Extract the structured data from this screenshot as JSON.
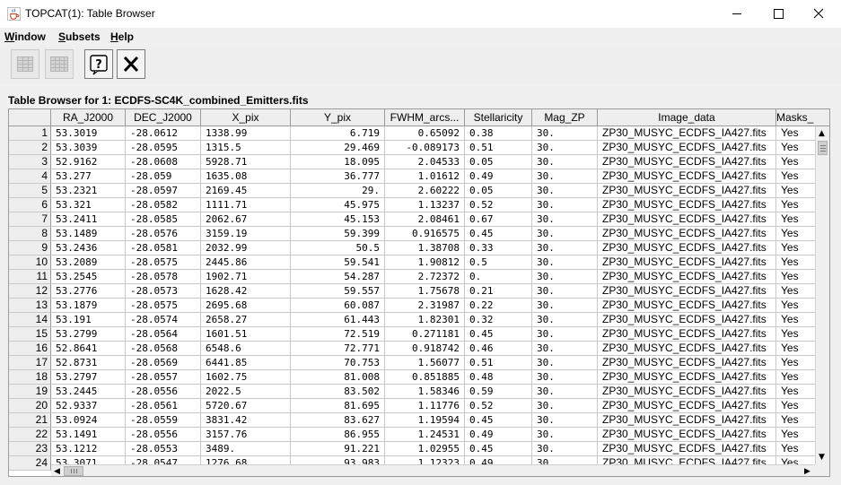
{
  "window": {
    "title": "TOPCAT(1): Table Browser",
    "app_icon": "java-cup-icon",
    "controls": [
      "minimize-icon",
      "maximize-icon",
      "close-icon"
    ]
  },
  "menu": {
    "items": [
      {
        "label": "Window",
        "mnemonic": "W",
        "rest": "indow"
      },
      {
        "label": "Subsets",
        "mnemonic": "S",
        "rest": "ubsets"
      },
      {
        "label": "Help",
        "mnemonic": "H",
        "rest": "elp"
      }
    ]
  },
  "toolbar": {
    "buttons": [
      {
        "icon": "table-grid-icon",
        "enabled": false
      },
      {
        "icon": "table-grid-alt-icon",
        "enabled": false
      },
      {
        "icon": "help-icon",
        "enabled": true
      },
      {
        "icon": "close-x-icon",
        "enabled": true
      }
    ]
  },
  "browser": {
    "label": "Table Browser for 1: ECDFS-SC4K_combined_Emitters.fits"
  },
  "table": {
    "columns": [
      "",
      "RA_J2000",
      "DEC_J2000",
      "X_pix",
      "Y_pix",
      "FWHM_arcs...",
      "Stellaricity",
      "Mag_ZP",
      "Image_data",
      "Masks_"
    ],
    "rows": [
      [
        "1",
        "53.3019",
        "-28.0612",
        "1338.99",
        "6.719",
        "0.65092",
        "0.38",
        "30.",
        "ZP30_MUSYC_ECDFS_IA427.fits",
        "Yes"
      ],
      [
        "2",
        "53.3039",
        "-28.0595",
        "1315.5",
        "29.469",
        "-0.089173",
        "0.51",
        "30.",
        "ZP30_MUSYC_ECDFS_IA427.fits",
        "Yes"
      ],
      [
        "3",
        "52.9162",
        "-28.0608",
        "5928.71",
        "18.095",
        "2.04533",
        "0.05",
        "30.",
        "ZP30_MUSYC_ECDFS_IA427.fits",
        "Yes"
      ],
      [
        "4",
        "53.277",
        "-28.059",
        "1635.08",
        "36.777",
        "1.01612",
        "0.49",
        "30.",
        "ZP30_MUSYC_ECDFS_IA427.fits",
        "Yes"
      ],
      [
        "5",
        "53.2321",
        "-28.0597",
        "2169.45",
        "29.",
        "2.60222",
        "0.05",
        "30.",
        "ZP30_MUSYC_ECDFS_IA427.fits",
        "Yes"
      ],
      [
        "6",
        "53.321",
        "-28.0582",
        "1111.71",
        "45.975",
        "1.13237",
        "0.52",
        "30.",
        "ZP30_MUSYC_ECDFS_IA427.fits",
        "Yes"
      ],
      [
        "7",
        "53.2411",
        "-28.0585",
        "2062.67",
        "45.153",
        "2.08461",
        "0.67",
        "30.",
        "ZP30_MUSYC_ECDFS_IA427.fits",
        "Yes"
      ],
      [
        "8",
        "53.1489",
        "-28.0576",
        "3159.19",
        "59.399",
        "0.916575",
        "0.45",
        "30.",
        "ZP30_MUSYC_ECDFS_IA427.fits",
        "Yes"
      ],
      [
        "9",
        "53.2436",
        "-28.0581",
        "2032.99",
        "50.5",
        "1.38708",
        "0.33",
        "30.",
        "ZP30_MUSYC_ECDFS_IA427.fits",
        "Yes"
      ],
      [
        "10",
        "53.2089",
        "-28.0575",
        "2445.86",
        "59.541",
        "1.90812",
        "0.5",
        "30.",
        "ZP30_MUSYC_ECDFS_IA427.fits",
        "Yes"
      ],
      [
        "11",
        "53.2545",
        "-28.0578",
        "1902.71",
        "54.287",
        "2.72372",
        "0.",
        "30.",
        "ZP30_MUSYC_ECDFS_IA427.fits",
        "Yes"
      ],
      [
        "12",
        "53.2776",
        "-28.0573",
        "1628.42",
        "59.557",
        "1.75678",
        "0.21",
        "30.",
        "ZP30_MUSYC_ECDFS_IA427.fits",
        "Yes"
      ],
      [
        "13",
        "53.1879",
        "-28.0575",
        "2695.68",
        "60.087",
        "2.31987",
        "0.22",
        "30.",
        "ZP30_MUSYC_ECDFS_IA427.fits",
        "Yes"
      ],
      [
        "14",
        "53.191",
        "-28.0574",
        "2658.27",
        "61.443",
        "1.82301",
        "0.32",
        "30.",
        "ZP30_MUSYC_ECDFS_IA427.fits",
        "Yes"
      ],
      [
        "15",
        "53.2799",
        "-28.0564",
        "1601.51",
        "72.519",
        "0.271181",
        "0.45",
        "30.",
        "ZP30_MUSYC_ECDFS_IA427.fits",
        "Yes"
      ],
      [
        "16",
        "52.8641",
        "-28.0568",
        "6548.6",
        "72.771",
        "0.918742",
        "0.46",
        "30.",
        "ZP30_MUSYC_ECDFS_IA427.fits",
        "Yes"
      ],
      [
        "17",
        "52.8731",
        "-28.0569",
        "6441.85",
        "70.753",
        "1.56077",
        "0.51",
        "30.",
        "ZP30_MUSYC_ECDFS_IA427.fits",
        "Yes"
      ],
      [
        "18",
        "53.2797",
        "-28.0557",
        "1602.75",
        "81.008",
        "0.851885",
        "0.48",
        "30.",
        "ZP30_MUSYC_ECDFS_IA427.fits",
        "Yes"
      ],
      [
        "19",
        "53.2445",
        "-28.0556",
        "2022.5",
        "83.502",
        "1.58346",
        "0.59",
        "30.",
        "ZP30_MUSYC_ECDFS_IA427.fits",
        "Yes"
      ],
      [
        "20",
        "52.9337",
        "-28.0561",
        "5720.67",
        "81.695",
        "1.11776",
        "0.52",
        "30.",
        "ZP30_MUSYC_ECDFS_IA427.fits",
        "Yes"
      ],
      [
        "21",
        "53.0924",
        "-28.0559",
        "3831.42",
        "83.627",
        "1.19594",
        "0.45",
        "30.",
        "ZP30_MUSYC_ECDFS_IA427.fits",
        "Yes"
      ],
      [
        "22",
        "53.1491",
        "-28.0556",
        "3157.76",
        "86.955",
        "1.24531",
        "0.49",
        "30.",
        "ZP30_MUSYC_ECDFS_IA427.fits",
        "Yes"
      ],
      [
        "23",
        "53.1212",
        "-28.0553",
        "3489.",
        "91.221",
        "1.02955",
        "0.45",
        "30.",
        "ZP30_MUSYC_ECDFS_IA427.fits",
        "Yes"
      ],
      [
        "24",
        "53.3071",
        "-28.0547",
        "1276.68",
        "93.983",
        "1.12323",
        "0.49",
        "30.",
        "ZP30_MUSYC_ECDFS_IA427.fits",
        "Yes"
      ]
    ]
  }
}
